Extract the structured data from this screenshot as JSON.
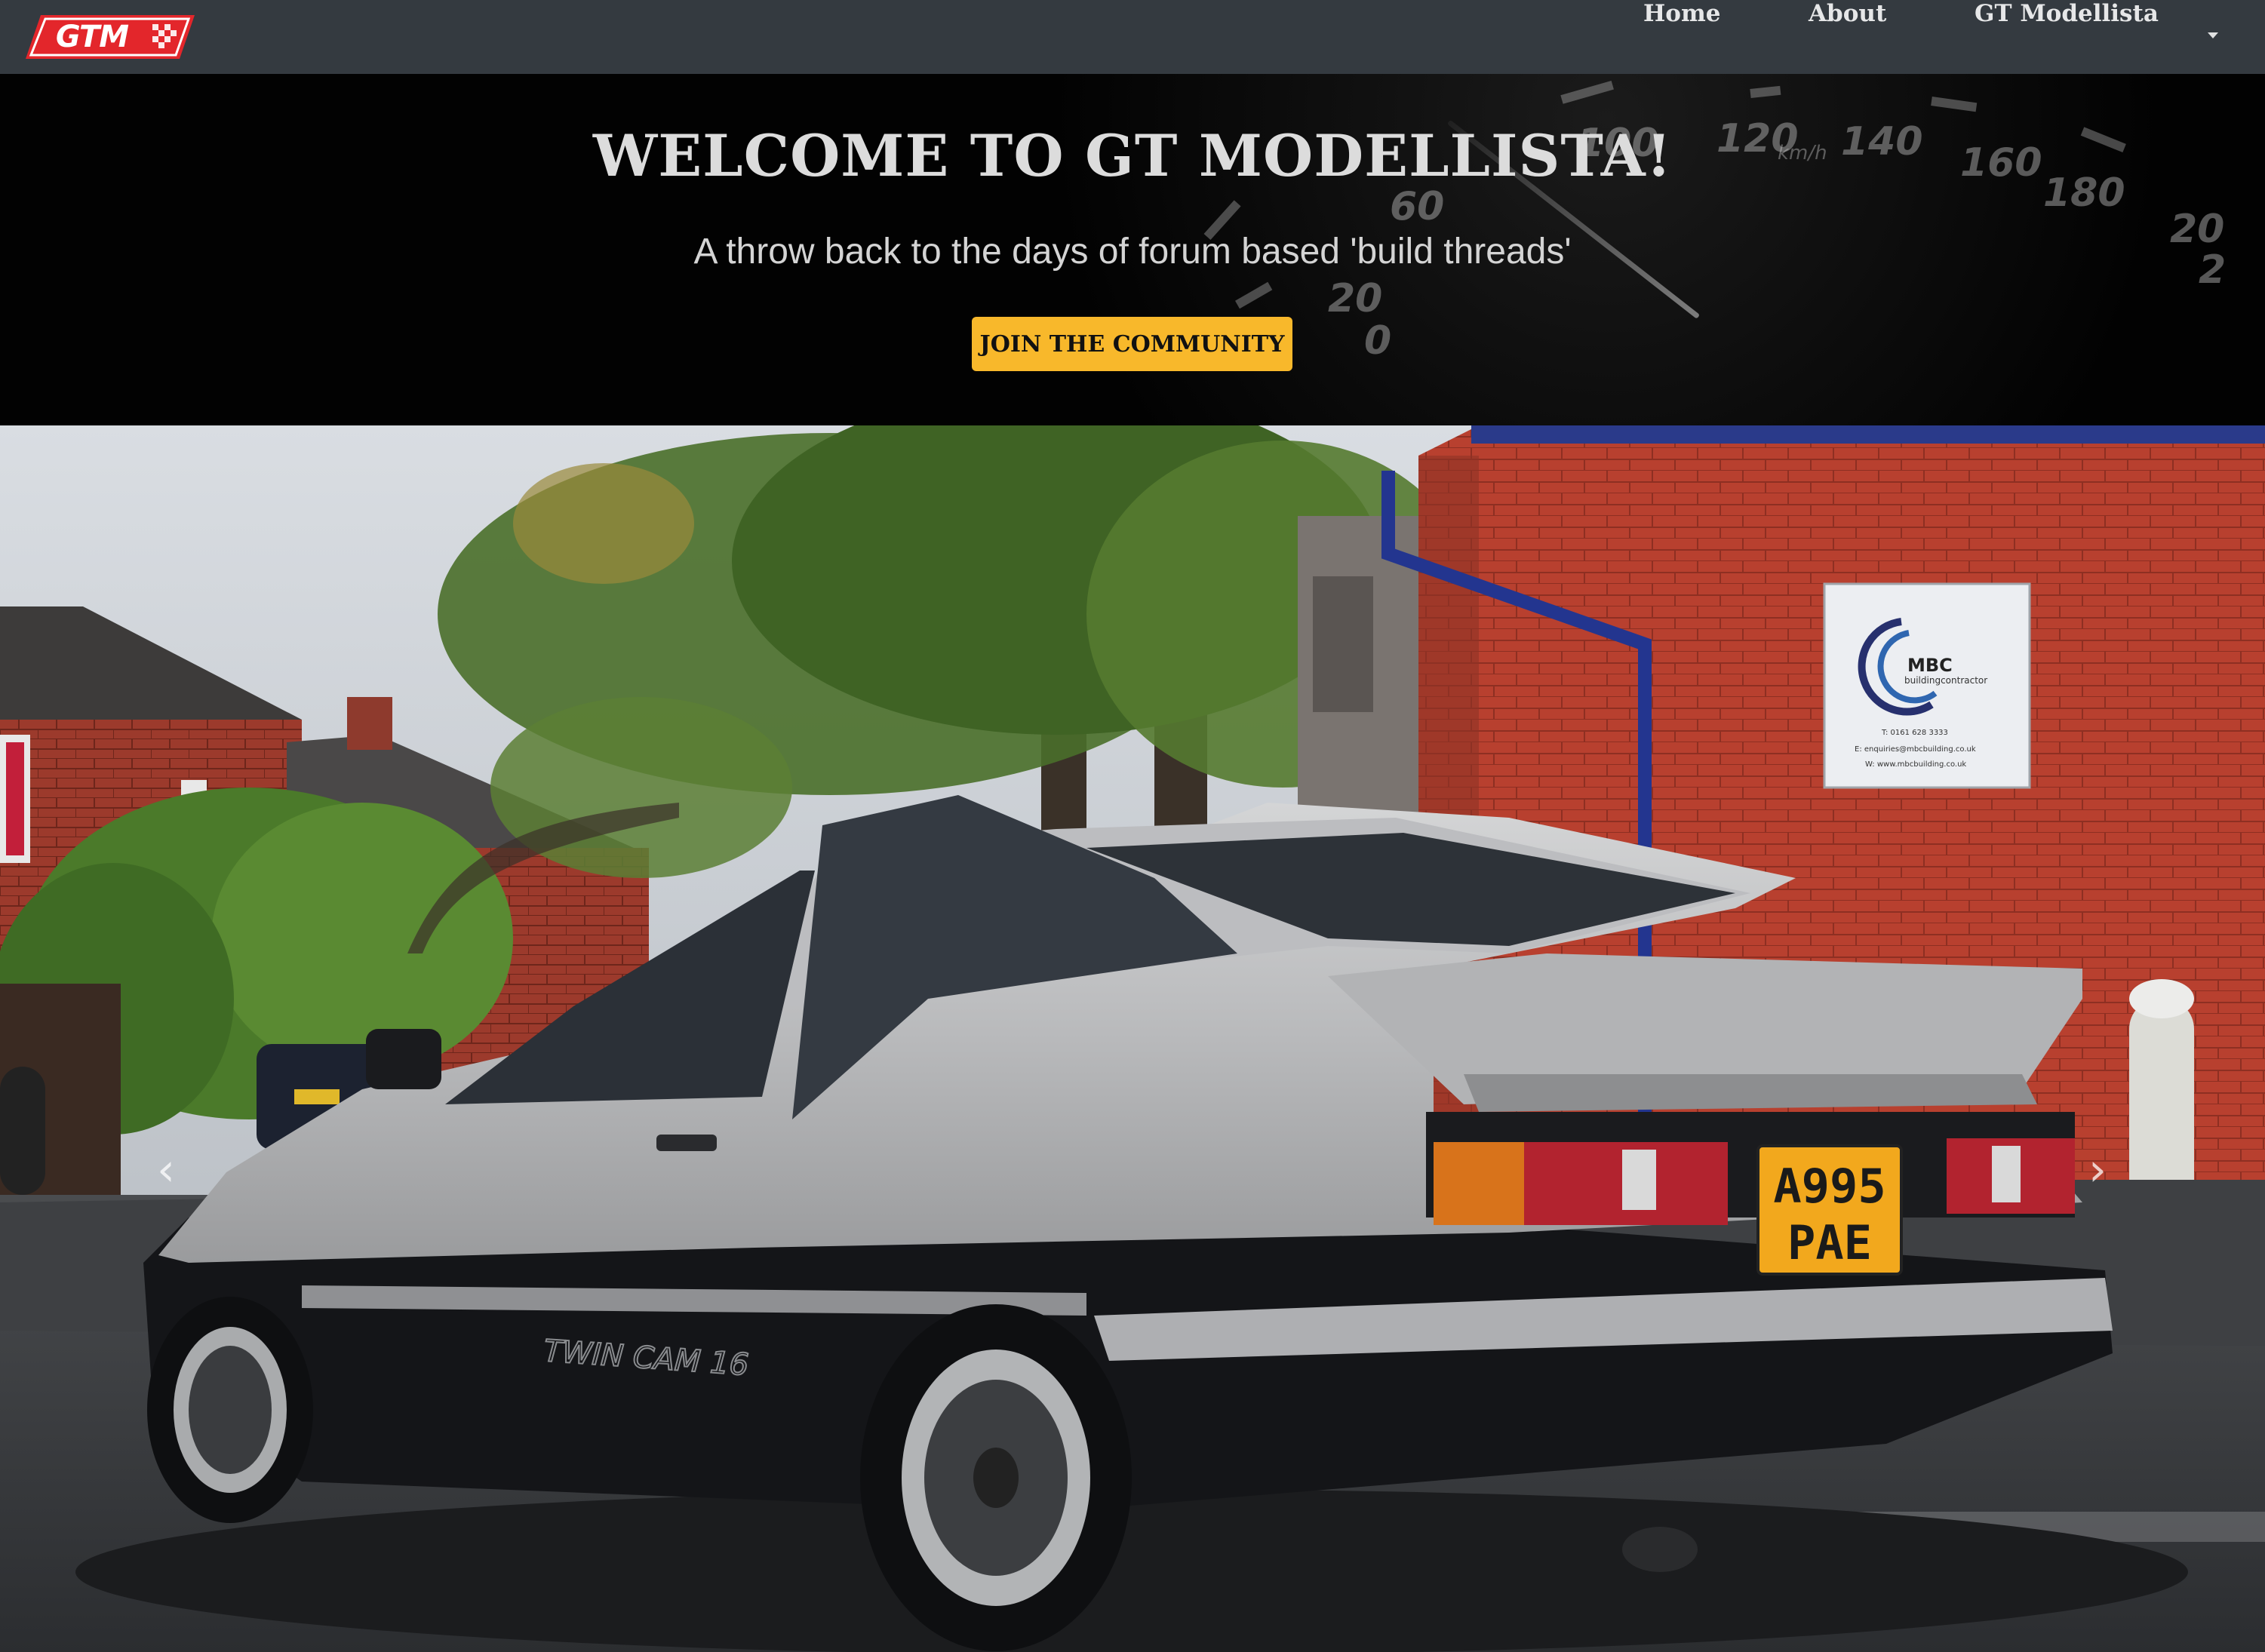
{
  "brand": {
    "logo_text": "GTM"
  },
  "nav": {
    "items": [
      {
        "label": "Home"
      },
      {
        "label": "About"
      },
      {
        "label": "GT Modellista"
      }
    ]
  },
  "hero": {
    "title": "WELCOME TO GT MODELLISTA!",
    "subtitle": "A throw back to the days of forum based 'build threads'",
    "cta_label": "JOIN THE COMMUNITY",
    "gauge": {
      "unit": "km/h",
      "numbers": [
        "0",
        "20",
        "60",
        "100",
        "120",
        "140",
        "160",
        "180",
        "20",
        "2"
      ]
    }
  },
  "carousel": {
    "car_badge": "TWIN CAM 16",
    "plate_line1": "A995",
    "plate_line2": "PAE",
    "sign": {
      "name": "MBC",
      "subtitle": "buildingcontractor",
      "phone": "T: 0161 628 3333",
      "email": "E: enquiries@mbcbuilding.co.uk",
      "web": "W: www.mbcbuilding.co.uk"
    },
    "prev_icon": "chevron-left-icon",
    "next_icon": "chevron-right-icon"
  },
  "colors": {
    "navbar": "#343a40",
    "cta": "#f8b82b",
    "logo_red": "#e3262b",
    "brick": "#b8402f"
  }
}
